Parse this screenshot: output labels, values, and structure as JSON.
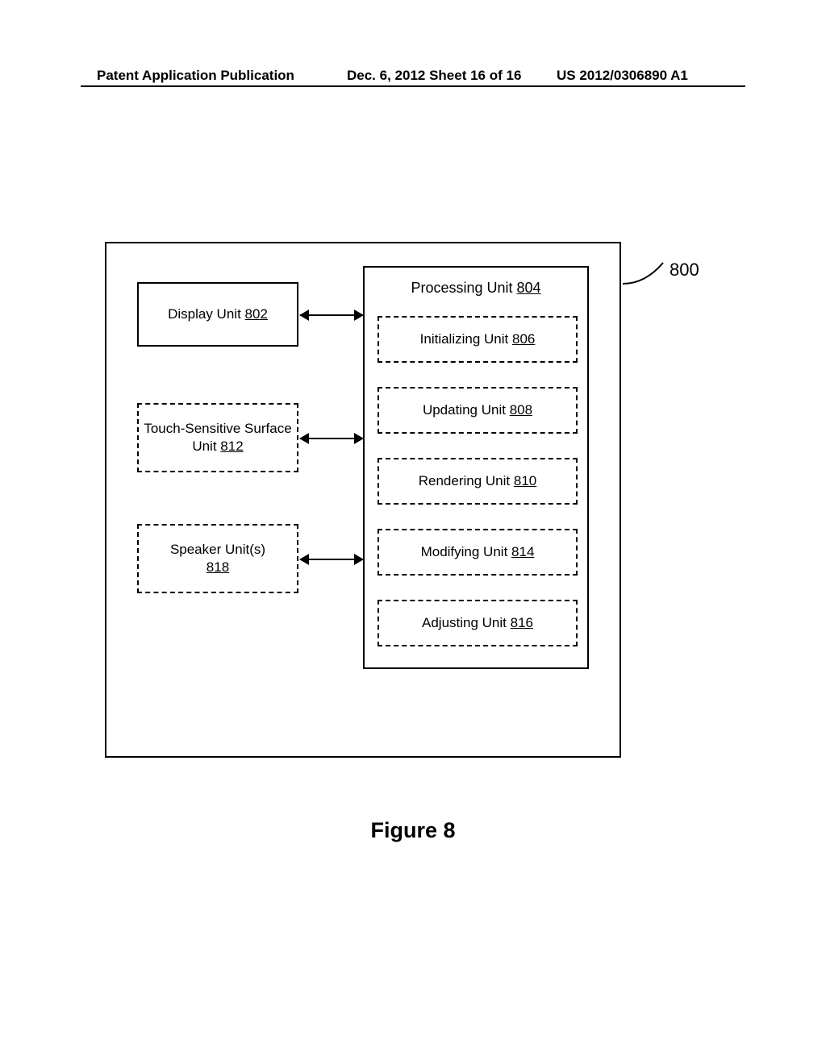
{
  "header": {
    "left": "Patent Application Publication",
    "center": "Dec. 6, 2012  Sheet 16 of 16",
    "right": "US 2012/0306890 A1"
  },
  "figure": {
    "caption": "Figure 8",
    "ref": "800"
  },
  "units": {
    "display": {
      "label": "Display Unit",
      "ref": "802"
    },
    "touch": {
      "label": "Touch-Sensitive Surface Unit",
      "ref": "812"
    },
    "speaker": {
      "label": "Speaker Unit(s)",
      "ref": "818"
    },
    "processing": {
      "label": "Processing Unit",
      "ref": "804"
    },
    "initializing": {
      "label": "Initializing Unit",
      "ref": "806"
    },
    "updating": {
      "label": "Updating Unit",
      "ref": "808"
    },
    "rendering": {
      "label": "Rendering Unit",
      "ref": "810"
    },
    "modifying": {
      "label": "Modifying Unit",
      "ref": "814"
    },
    "adjusting": {
      "label": "Adjusting Unit",
      "ref": "816"
    }
  }
}
